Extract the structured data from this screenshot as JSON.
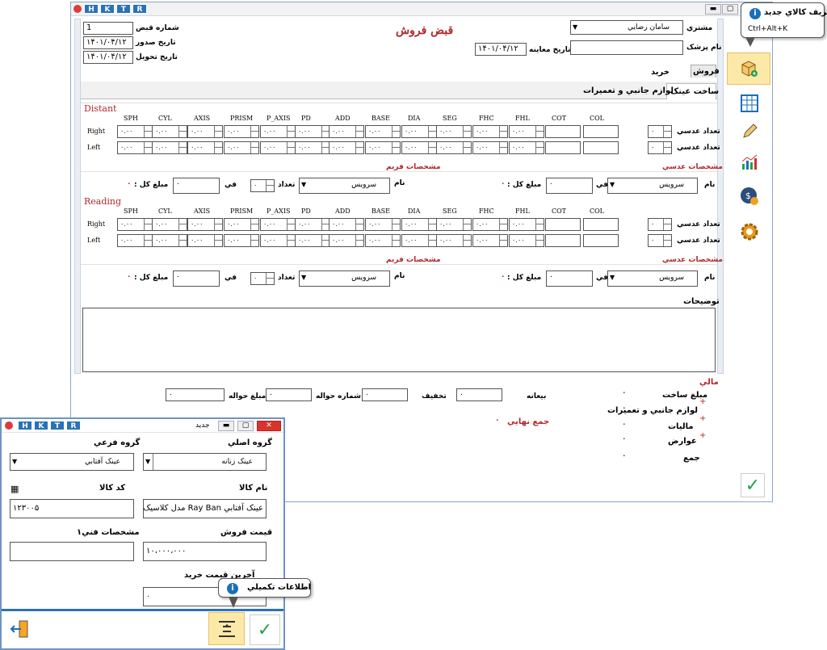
{
  "main": {
    "title_keys": [
      "H",
      "K",
      "T",
      "R"
    ],
    "form_title": "قبض فروش",
    "labels": {
      "receipt_no": "شماره قبض",
      "issue_date": "تاريخ صدور",
      "delivery_date": "تاريخ تحويل",
      "customer": "مشتري",
      "doctor": "نام پزشک",
      "exam_date": "تاريخ معاينه"
    },
    "values": {
      "receipt_no": "1",
      "issue_date": "۱۴۰۱/۰۴/۱۲",
      "delivery_date": "۱۴۰۱/۰۴/۱۲",
      "customer": "سامان رضايي",
      "doctor": "",
      "exam_date": "۱۴۰۱/۰۴/۱۲"
    },
    "tabs_top": [
      "فروش",
      "خريد"
    ],
    "tabs_sub": [
      "ساخت عينک",
      "لوازم جانبي و تعميرات"
    ],
    "columns": [
      "SPH",
      "CYL",
      "AXIS",
      "PRISM",
      "P_AXIS",
      "PD",
      "ADD",
      "BASE",
      "DIA",
      "SEG",
      "FHC",
      "FHL",
      "COT",
      "COL"
    ],
    "cell_value": "۰.۰۰",
    "sections": [
      {
        "title": "Distant",
        "rows": [
          "Right",
          "Left"
        ],
        "qty_label": "تعداد عدسي",
        "qty": "۰",
        "lens_spec": "مشخصات عدسي",
        "frame_spec": "مشخصات فريم",
        "name_label": "نام",
        "name_value": "سرويس",
        "fi_label": "في",
        "fi_value": "۰",
        "total_label": "مبلغ کل :",
        "total": "۰",
        "count_label": "تعداد",
        "count_value": "۰"
      },
      {
        "title": "Reading",
        "rows": [
          "Right",
          "Left"
        ],
        "qty_label": "تعداد عدسي",
        "qty": "۰",
        "lens_spec": "مشخصات عدسي",
        "frame_spec": "مشخصات فريم",
        "name_label": "نام",
        "name_value": "سرويس",
        "fi_label": "في",
        "fi_value": "۰",
        "total_label": "مبلغ کل :",
        "total": "۰",
        "count_label": "تعداد",
        "count_value": "۰"
      }
    ],
    "notes_label": "توضيحات",
    "finance": {
      "title": "مالي",
      "items": [
        "مبلغ ساخت",
        "لوازم جانبي و تعميرات",
        "ماليات",
        "عوارض",
        "جمع"
      ],
      "zero": "۰",
      "prepay": "بيعانه",
      "discount": "تخفيف",
      "transfer_no": "شماره حواله",
      "transfer_amount": "مبلغ حواله",
      "grand_total": "جمع نهايي"
    }
  },
  "tooltip_top": {
    "title": "تعريف کالاي جديد",
    "shortcut": "Ctrl+Alt+K"
  },
  "dialog": {
    "title_keys": [
      "H",
      "K",
      "T",
      "R"
    ],
    "title": "جديد",
    "labels": {
      "main_group": "گروه اصلي",
      "sub_group": "گروه فرعي",
      "item_name": "نام کالا",
      "item_code": "کد کالا",
      "sale_price": "قيمت فروش",
      "tech_spec": "مشخصات فني۱",
      "buy_price": "آخرين قيمت خريد"
    },
    "values": {
      "main_group": "عينک زنانه",
      "sub_group": "عينک آفتابي",
      "item_name": "عينک آفتابي Ray Ban مدل کلاسيک",
      "item_code": "۱۲۳۰۰۵",
      "sale_price": "۱۰،۰۰۰،۰۰۰",
      "tech_spec": "",
      "buy_price": "۰"
    }
  },
  "tooltip_bottom": {
    "title": "اطلاعات تکميلي"
  }
}
